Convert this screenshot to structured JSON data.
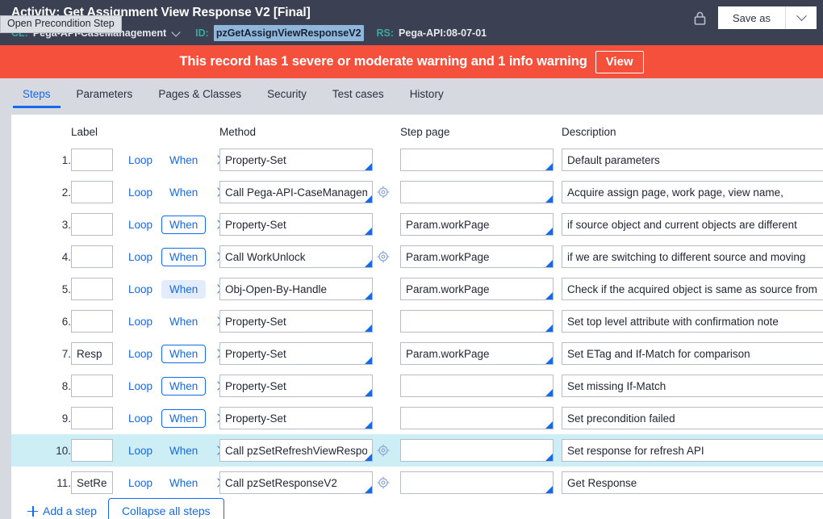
{
  "header": {
    "title": "Activity: Get Assignment View Response V2 [Final]",
    "class_key": "CL:",
    "class_value": "Pega-API-CaseManagement",
    "id_key": "ID:",
    "id_value": "pzGetAssignViewResponseV2",
    "rs_key": "RS:",
    "rs_value": "Pega-API:08-07-01",
    "lock_icon": "lock-icon",
    "save_as_label": "Save as",
    "save_as_caret_icon": "chevron-down-icon"
  },
  "tooltip": {
    "text": "Open Precondition Step"
  },
  "warning": {
    "message": "This record has 1 severe or moderate warning and 1 info warning",
    "view_label": "View",
    "color": "#f4503c"
  },
  "tabs": [
    {
      "label": "Steps",
      "active": true
    },
    {
      "label": "Parameters",
      "active": false
    },
    {
      "label": "Pages & Classes",
      "active": false
    },
    {
      "label": "Security",
      "active": false
    },
    {
      "label": "Test cases",
      "active": false
    },
    {
      "label": "History",
      "active": false
    }
  ],
  "table": {
    "columns": {
      "label": "Label",
      "method": "Method",
      "step_page": "Step page",
      "description": "Description"
    },
    "controls": {
      "loop": "Loop",
      "when": "When",
      "expand_icon": "chevron-right-icon",
      "target_icon": "target-icon"
    },
    "rows": [
      {
        "num": "1.",
        "label": "",
        "when_style": "plain",
        "method": "Property-Set",
        "has_target": false,
        "step_page": "",
        "description": "Default parameters",
        "highlight": false
      },
      {
        "num": "2.",
        "label": "",
        "when_style": "plain",
        "method": "Call Pega-API-CaseManagement",
        "has_target": true,
        "step_page": "",
        "description": "Acquire assign page, work page, view name,",
        "highlight": false
      },
      {
        "num": "3.",
        "label": "",
        "when_style": "outlined",
        "method": "Property-Set",
        "has_target": false,
        "step_page": "Param.workPage",
        "description": "if source object and current objects are different",
        "highlight": false
      },
      {
        "num": "4.",
        "label": "",
        "when_style": "outlined",
        "method": "Call WorkUnlock",
        "has_target": true,
        "step_page": "Param.workPage",
        "description": "if we are switching to different source and moving",
        "highlight": false
      },
      {
        "num": "5.",
        "label": "",
        "when_style": "filled",
        "method": "Obj-Open-By-Handle",
        "has_target": false,
        "step_page": "Param.workPage",
        "description": "Check if the acquired object is same as source from",
        "highlight": false
      },
      {
        "num": "6.",
        "label": "",
        "when_style": "plain",
        "method": "Property-Set",
        "has_target": false,
        "step_page": "",
        "description": "Set top level attribute with confirmation note",
        "highlight": false
      },
      {
        "num": "7.",
        "label": "Resp",
        "when_style": "outlined",
        "method": "Property-Set",
        "has_target": false,
        "step_page": "Param.workPage",
        "description": "Set ETag and If-Match for comparison",
        "highlight": false
      },
      {
        "num": "8.",
        "label": "",
        "when_style": "outlined",
        "method": "Property-Set",
        "has_target": false,
        "step_page": "",
        "description": "Set missing If-Match",
        "highlight": false
      },
      {
        "num": "9.",
        "label": "",
        "when_style": "outlined",
        "method": "Property-Set",
        "has_target": false,
        "step_page": "",
        "description": "Set precondition failed",
        "highlight": false
      },
      {
        "num": "10.",
        "label": "",
        "when_style": "plain",
        "method": "Call pzSetRefreshViewResponse",
        "has_target": true,
        "step_page": "",
        "description": "Set response for refresh API",
        "highlight": true
      },
      {
        "num": "11.",
        "label": "SetRes",
        "when_style": "plain",
        "method": "Call pzSetResponseV2",
        "has_target": true,
        "step_page": "",
        "description": "Get Response",
        "highlight": false
      }
    ]
  },
  "footer": {
    "add_step_label": "Add a step",
    "add_step_icon": "plus-icon",
    "collapse_label": "Collapse all steps"
  }
}
